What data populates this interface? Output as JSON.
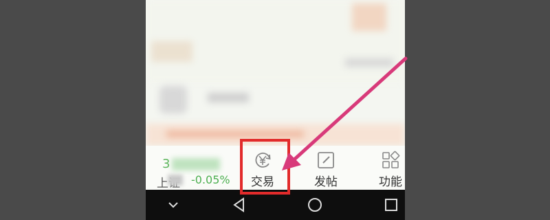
{
  "index_widget": {
    "number_partial": "3",
    "name": "上证",
    "change": "-0.05%"
  },
  "tabs": [
    {
      "label": "交易",
      "icon": "yen-cycle-icon"
    },
    {
      "label": "发帖",
      "icon": "edit-square-icon"
    },
    {
      "label": "功能",
      "icon": "grid-apps-icon"
    }
  ],
  "navbar": {
    "icons": [
      "chevron-down-icon",
      "back-triangle-icon",
      "home-circle-icon",
      "recents-square-icon"
    ]
  },
  "colors": {
    "highlight": "#e22b2b",
    "arrow": "#d83a7a",
    "positive_green": "#4caf50"
  }
}
